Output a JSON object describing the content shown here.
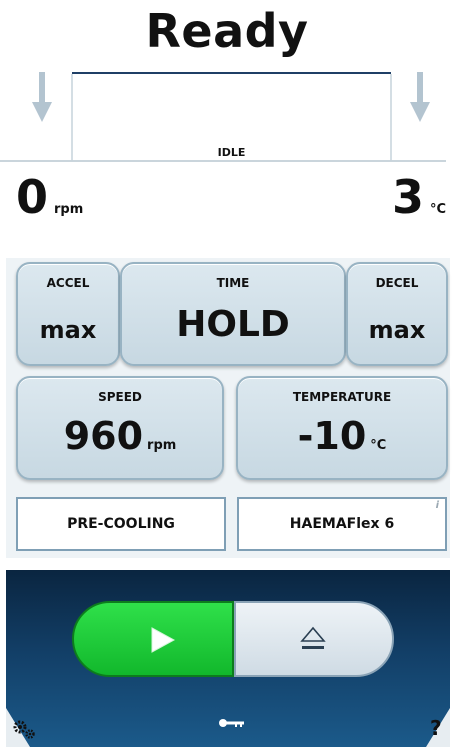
{
  "status": {
    "title": "Ready",
    "phase": "IDLE"
  },
  "readouts": {
    "speed": {
      "value": "0",
      "unit": "rpm"
    },
    "temperature": {
      "value": "3",
      "unit": "°C"
    }
  },
  "parameters": {
    "accel": {
      "label": "ACCEL",
      "value": "max"
    },
    "time": {
      "label": "TIME",
      "value": "HOLD"
    },
    "decel": {
      "label": "DECEL",
      "value": "max"
    },
    "speed": {
      "label": "SPEED",
      "value": "960",
      "unit": "rpm"
    },
    "temperature": {
      "label": "TEMPERATURE",
      "value": "-10",
      "unit": "°C"
    }
  },
  "buttons": {
    "precooling": "PRE-COOLING",
    "rotor": "HAEMAFlex 6",
    "info": "i",
    "help": "?"
  },
  "icons": {
    "start": "play-icon",
    "open_lid": "eject-icon",
    "lock": "key-icon",
    "settings": "gears-icon",
    "help": "help-icon",
    "ramp_up": "arrow-down-icon",
    "ramp_down": "arrow-down-icon"
  },
  "colors": {
    "start_green": "#19c232",
    "tile_fill": "#d3e2ea",
    "tile_border": "#98b3c3",
    "control_navy": "#0d2d4c",
    "profile_line": "#1f3f66"
  }
}
